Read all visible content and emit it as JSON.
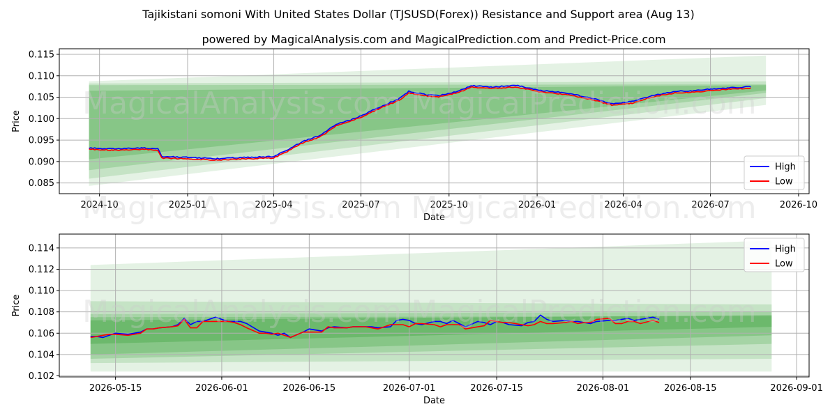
{
  "title": "Tajikistani somoni With United States Dollar (TJSUSD(Forex)) Resistance and Support area (Aug 13)",
  "subtitle": "powered by MagicalAnalysis.com and MagicalPrediction.com and Predict-Price.com",
  "watermarks": [
    "MagicalAnalysis.com",
    "MagicalPrediction.com"
  ],
  "colors": {
    "high": "#0000ff",
    "low": "#ff0000",
    "band": "#2e9a2e",
    "grid": "#b0b0b0"
  },
  "chart_data": [
    {
      "type": "line",
      "xlabel": "Date",
      "ylabel": "Price",
      "x_tick_labels": [
        "2024-10",
        "2025-01",
        "2025-04",
        "2025-07",
        "2025-10",
        "2026-01",
        "2026-04",
        "2026-07",
        "2026-10"
      ],
      "y_tick_labels": [
        "0.085",
        "0.090",
        "0.095",
        "0.100",
        "0.105",
        "0.110",
        "0.115"
      ],
      "xlim": [
        "2024-08-20",
        "2026-10-12"
      ],
      "ylim": [
        0.0825,
        0.1163
      ],
      "legend": {
        "position": "lower-right",
        "entries": [
          "High",
          "Low"
        ]
      },
      "grid": true,
      "price_path": [
        [
          "2024-09-20",
          0.093
        ],
        [
          "2024-10-15",
          0.0928
        ],
        [
          "2024-11-15",
          0.093
        ],
        [
          "2024-12-01",
          0.0928
        ],
        [
          "2024-12-05",
          0.091
        ],
        [
          "2025-01-01",
          0.0908
        ],
        [
          "2025-02-01",
          0.0905
        ],
        [
          "2025-03-01",
          0.0908
        ],
        [
          "2025-04-01",
          0.091
        ],
        [
          "2025-04-15",
          0.0925
        ],
        [
          "2025-05-01",
          0.0945
        ],
        [
          "2025-05-20",
          0.096
        ],
        [
          "2025-06-05",
          0.0985
        ],
        [
          "2025-06-20",
          0.0995
        ],
        [
          "2025-07-01",
          0.1005
        ],
        [
          "2025-07-20",
          0.1025
        ],
        [
          "2025-08-10",
          0.1045
        ],
        [
          "2025-08-20",
          0.1062
        ],
        [
          "2025-09-05",
          0.1055
        ],
        [
          "2025-09-20",
          0.1052
        ],
        [
          "2025-10-10",
          0.1062
        ],
        [
          "2025-10-25",
          0.1075
        ],
        [
          "2025-11-15",
          0.1072
        ],
        [
          "2025-12-10",
          0.1076
        ],
        [
          "2026-01-01",
          0.1065
        ],
        [
          "2026-02-01",
          0.1058
        ],
        [
          "2026-03-01",
          0.1045
        ],
        [
          "2026-03-20",
          0.1033
        ],
        [
          "2026-04-10",
          0.1038
        ],
        [
          "2026-05-01",
          0.1052
        ],
        [
          "2026-05-25",
          0.1062
        ],
        [
          "2026-06-10",
          0.1063
        ],
        [
          "2026-07-01",
          0.1067
        ],
        [
          "2026-07-20",
          0.107
        ],
        [
          "2026-08-12",
          0.1073
        ]
      ],
      "bands": [
        {
          "x": [
            "2024-09-20",
            "2026-08-28"
          ],
          "low": [
            0.0843,
            0.1032
          ],
          "high": [
            0.1087,
            0.1147
          ]
        },
        {
          "x": [
            "2024-09-20",
            "2026-08-28"
          ],
          "low": [
            0.086,
            0.1048
          ],
          "high": [
            0.1082,
            0.1087
          ]
        },
        {
          "x": [
            "2024-09-20",
            "2026-08-28"
          ],
          "low": [
            0.088,
            0.106
          ],
          "high": [
            0.1078,
            0.108
          ]
        },
        {
          "x": [
            "2024-09-20",
            "2026-08-28"
          ],
          "low": [
            0.0905,
            0.1066
          ],
          "high": [
            0.1065,
            0.1078
          ]
        }
      ]
    },
    {
      "type": "line",
      "xlabel": "Date",
      "ylabel": "Price",
      "x_tick_labels": [
        "2026-05-15",
        "2026-06-01",
        "2026-06-15",
        "2026-07-01",
        "2026-07-15",
        "2026-08-01",
        "2026-08-15",
        "2026-09-01"
      ],
      "y_tick_labels": [
        "0.102",
        "0.104",
        "0.106",
        "0.108",
        "0.110",
        "0.112",
        "0.114"
      ],
      "xlim": [
        "2026-05-06",
        "2026-09-03"
      ],
      "ylim": [
        0.1019,
        0.1153
      ],
      "legend": {
        "position": "upper-right",
        "entries": [
          "High",
          "Low"
        ]
      },
      "grid": true,
      "series": [
        {
          "name": "High",
          "x": [
            "2026-05-11",
            "2026-05-12",
            "2026-05-13",
            "2026-05-14",
            "2026-05-15",
            "2026-05-17",
            "2026-05-18",
            "2026-05-19",
            "2026-05-20",
            "2026-05-21",
            "2026-05-22",
            "2026-05-24",
            "2026-05-25",
            "2026-05-26",
            "2026-05-27",
            "2026-05-28",
            "2026-05-29",
            "2026-05-31",
            "2026-06-01",
            "2026-06-02",
            "2026-06-03",
            "2026-06-04",
            "2026-06-05",
            "2026-06-07",
            "2026-06-08",
            "2026-06-09",
            "2026-06-10",
            "2026-06-11",
            "2026-06-12",
            "2026-06-14",
            "2026-06-15",
            "2026-06-16",
            "2026-06-17",
            "2026-06-18",
            "2026-06-19",
            "2026-06-21",
            "2026-06-22",
            "2026-06-23",
            "2026-06-24",
            "2026-06-25",
            "2026-06-26",
            "2026-06-28",
            "2026-06-29",
            "2026-06-30",
            "2026-07-01",
            "2026-07-02",
            "2026-07-03",
            "2026-07-05",
            "2026-07-06",
            "2026-07-07",
            "2026-07-08",
            "2026-07-09",
            "2026-07-10",
            "2026-07-12",
            "2026-07-13",
            "2026-07-14",
            "2026-07-15",
            "2026-07-16",
            "2026-07-17",
            "2026-07-19",
            "2026-07-20",
            "2026-07-21",
            "2026-07-22",
            "2026-07-23",
            "2026-07-24",
            "2026-07-26",
            "2026-07-27",
            "2026-07-28",
            "2026-07-29",
            "2026-07-30",
            "2026-07-31",
            "2026-08-02",
            "2026-08-03",
            "2026-08-04",
            "2026-08-05",
            "2026-08-06",
            "2026-08-07",
            "2026-08-09",
            "2026-08-10"
          ],
          "values": [
            0.1057,
            0.1057,
            0.1056,
            0.1058,
            0.106,
            0.1059,
            0.106,
            0.1061,
            0.1064,
            0.1064,
            0.1065,
            0.1066,
            0.1068,
            0.1074,
            0.1068,
            0.1071,
            0.1071,
            0.1075,
            0.1073,
            0.1071,
            0.1071,
            0.1071,
            0.1069,
            0.1062,
            0.1061,
            0.106,
            0.1058,
            0.106,
            0.1056,
            0.1061,
            0.1064,
            0.1063,
            0.1062,
            0.1065,
            0.1066,
            0.1065,
            0.1066,
            0.1066,
            0.1066,
            0.1066,
            0.1065,
            0.1066,
            0.1072,
            0.1073,
            0.1072,
            0.1069,
            0.1068,
            0.1071,
            0.1071,
            0.1069,
            0.1072,
            0.1069,
            0.1066,
            0.1071,
            0.107,
            0.1068,
            0.1071,
            0.107,
            0.1068,
            0.1067,
            0.107,
            0.1071,
            0.1077,
            0.1073,
            0.1071,
            0.1072,
            0.1071,
            0.1071,
            0.107,
            0.1069,
            0.1071,
            0.1072,
            0.1072,
            0.1073,
            0.1074,
            0.1072,
            0.1073,
            0.1075,
            0.1073
          ]
        },
        {
          "name": "Low",
          "x": [
            "2026-05-11",
            "2026-05-12",
            "2026-05-13",
            "2026-05-14",
            "2026-05-15",
            "2026-05-17",
            "2026-05-18",
            "2026-05-19",
            "2026-05-20",
            "2026-05-21",
            "2026-05-22",
            "2026-05-24",
            "2026-05-25",
            "2026-05-26",
            "2026-05-27",
            "2026-05-28",
            "2026-05-29",
            "2026-05-31",
            "2026-06-01",
            "2026-06-02",
            "2026-06-03",
            "2026-06-04",
            "2026-06-05",
            "2026-06-07",
            "2026-06-08",
            "2026-06-09",
            "2026-06-10",
            "2026-06-11",
            "2026-06-12",
            "2026-06-14",
            "2026-06-15",
            "2026-06-16",
            "2026-06-17",
            "2026-06-18",
            "2026-06-19",
            "2026-06-21",
            "2026-06-22",
            "2026-06-23",
            "2026-06-24",
            "2026-06-25",
            "2026-06-26",
            "2026-06-28",
            "2026-06-29",
            "2026-06-30",
            "2026-07-01",
            "2026-07-02",
            "2026-07-03",
            "2026-07-05",
            "2026-07-06",
            "2026-07-07",
            "2026-07-08",
            "2026-07-09",
            "2026-07-10",
            "2026-07-12",
            "2026-07-13",
            "2026-07-14",
            "2026-07-15",
            "2026-07-16",
            "2026-07-17",
            "2026-07-19",
            "2026-07-20",
            "2026-07-21",
            "2026-07-22",
            "2026-07-23",
            "2026-07-24",
            "2026-07-26",
            "2026-07-27",
            "2026-07-28",
            "2026-07-29",
            "2026-07-30",
            "2026-07-31",
            "2026-08-02",
            "2026-08-03",
            "2026-08-04",
            "2026-08-05",
            "2026-08-06",
            "2026-08-07",
            "2026-08-09",
            "2026-08-10"
          ],
          "values": [
            0.1056,
            0.1057,
            0.1058,
            0.1059,
            0.1059,
            0.1058,
            0.1059,
            0.106,
            0.1064,
            0.1064,
            0.1065,
            0.1066,
            0.1067,
            0.1073,
            0.1065,
            0.1065,
            0.1071,
            0.1071,
            0.1071,
            0.1071,
            0.107,
            0.1068,
            0.1065,
            0.106,
            0.106,
            0.1059,
            0.106,
            0.1058,
            0.1056,
            0.1061,
            0.1061,
            0.1061,
            0.1061,
            0.1066,
            0.1065,
            0.1065,
            0.1066,
            0.1066,
            0.1066,
            0.1065,
            0.1064,
            0.1068,
            0.1068,
            0.1068,
            0.1066,
            0.1069,
            0.1069,
            0.1068,
            0.1066,
            0.1068,
            0.1068,
            0.1068,
            0.1064,
            0.1066,
            0.1067,
            0.1072,
            0.1071,
            0.107,
            0.107,
            0.1068,
            0.1067,
            0.1068,
            0.1071,
            0.1069,
            0.1069,
            0.107,
            0.1071,
            0.1069,
            0.107,
            0.107,
            0.1073,
            0.1074,
            0.1069,
            0.1069,
            0.1071,
            0.1071,
            0.1069,
            0.1072,
            0.107
          ]
        }
      ],
      "bands": [
        {
          "x": [
            "2026-05-11",
            "2026-08-28"
          ],
          "low": [
            0.1024,
            0.1024
          ],
          "high": [
            0.1124,
            0.1147
          ]
        },
        {
          "x": [
            "2026-05-11",
            "2026-08-28"
          ],
          "low": [
            0.1032,
            0.1036
          ],
          "high": [
            0.109,
            0.1087
          ]
        },
        {
          "x": [
            "2026-05-11",
            "2026-08-28"
          ],
          "low": [
            0.1036,
            0.105
          ],
          "high": [
            0.1078,
            0.108
          ]
        },
        {
          "x": [
            "2026-05-11",
            "2026-08-28"
          ],
          "low": [
            0.104,
            0.1058
          ],
          "high": [
            0.1075,
            0.1076
          ]
        },
        {
          "x": [
            "2026-05-11",
            "2026-08-28"
          ],
          "low": [
            0.105,
            0.1066
          ],
          "high": [
            0.1072,
            0.1077
          ]
        }
      ]
    }
  ]
}
